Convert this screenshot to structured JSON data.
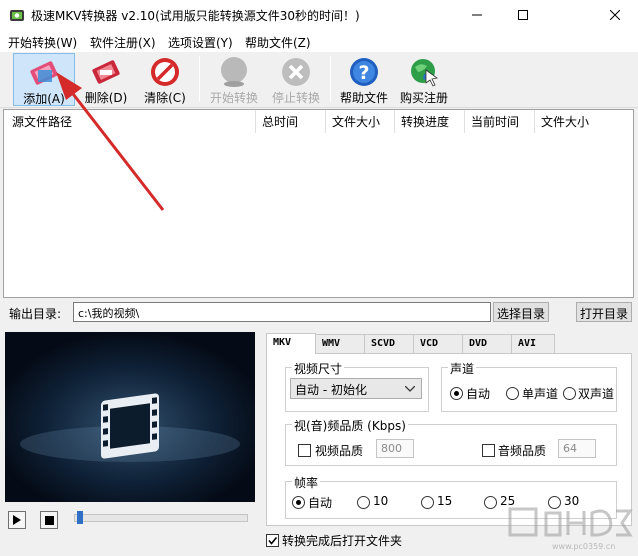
{
  "window": {
    "title": "极速MKV转换器 v2.10(试用版只能转换源文件30秒的时间！)"
  },
  "menu": [
    {
      "label": "开始转换(W)"
    },
    {
      "label": "软件注册(X)"
    },
    {
      "label": "选项设置(Y)"
    },
    {
      "label": "帮助文件(Z)"
    }
  ],
  "toolbar": {
    "add": "添加(A)",
    "delete": "删除(D)",
    "clear": "清除(C)",
    "start": "开始转换",
    "stop": "停止转换",
    "help": "帮助文件",
    "buy": "购买注册"
  },
  "file_list": {
    "columns": [
      "源文件路径",
      "总时间",
      "文件大小",
      "转换进度",
      "当前时间",
      "文件大小"
    ]
  },
  "output": {
    "label": "输出目录:",
    "path": "c:\\我的视频\\",
    "choose_button": "选择目录",
    "open_button": "打开目录"
  },
  "playback": {
    "progress": 0.02
  },
  "tabs": [
    "MKV",
    "WMV",
    "SCVD",
    "VCD",
    "DVD",
    "AVI"
  ],
  "settings": {
    "video_size": {
      "title": "视频尺寸",
      "selected": "自动 - 初始化"
    },
    "channel": {
      "title": "声道",
      "options": [
        "自动",
        "单声道",
        "双声道"
      ],
      "selected": "自动"
    },
    "quality": {
      "title": "视(音)频品质 (Kbps)",
      "video_label": "视频品质",
      "video_value": "800",
      "audio_label": "音频品质",
      "audio_value": "64"
    },
    "framerate": {
      "title": "帧率",
      "options": [
        "自动",
        "10",
        "15",
        "25",
        "30"
      ],
      "selected": "自动"
    }
  },
  "open_after": {
    "label": "转换完成后打开文件夹",
    "checked": true
  },
  "watermark": {
    "text": "www.pc0359.cn"
  },
  "colors": {
    "accent_blue": "#2f6fc4",
    "arrow_red": "#d42a2a",
    "selected_tool": "#cfe6fa"
  }
}
